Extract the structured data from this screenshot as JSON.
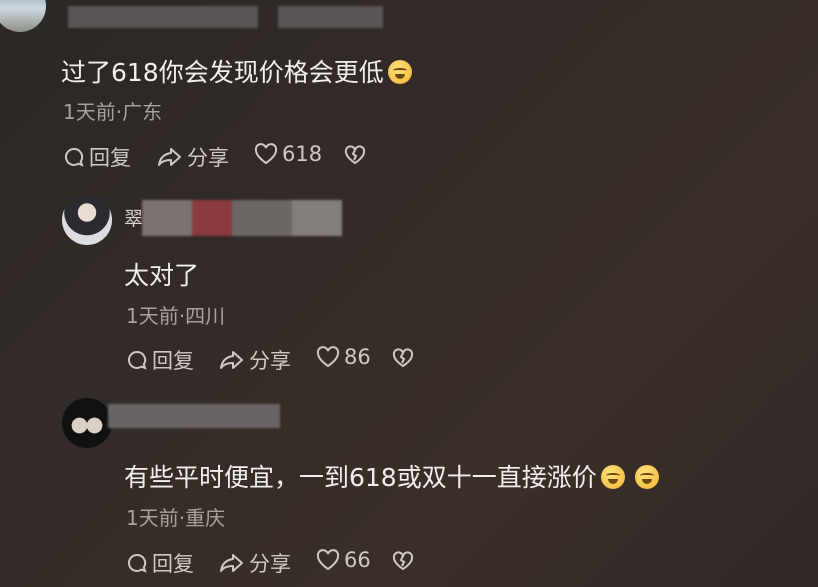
{
  "comments": [
    {
      "text": "过了618你会发现价格会更低",
      "meta": "1天前·广东",
      "reply_label": "回复",
      "share_label": "分享",
      "like_count": "618"
    },
    {
      "username_prefix": "翠",
      "text": "太对了",
      "meta": "1天前·四川",
      "reply_label": "回复",
      "share_label": "分享",
      "like_count": "86"
    },
    {
      "text": "有些平时便宜，一到618或双十一直接涨价",
      "meta": "1天前·重庆",
      "reply_label": "回复",
      "share_label": "分享",
      "like_count": "66"
    }
  ],
  "colors": {
    "background": "#322a27",
    "text": "#f2efec",
    "meta": "#a8a19c"
  }
}
